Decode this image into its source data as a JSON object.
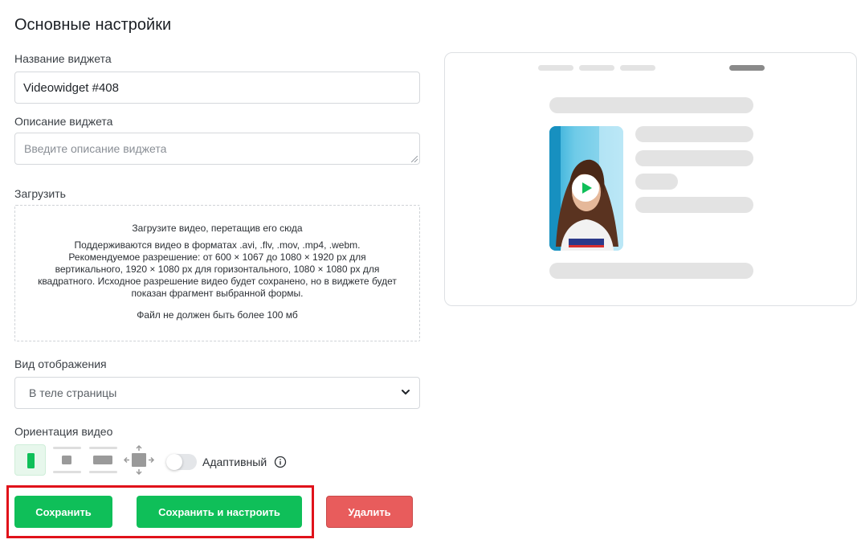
{
  "page": {
    "title": "Основные настройки"
  },
  "widget_name": {
    "label": "Название виджета",
    "value": "Videowidget #408"
  },
  "widget_description": {
    "label": "Описание виджета",
    "placeholder": "Введите описание виджета"
  },
  "upload": {
    "label": "Загрузить",
    "drop_title": "Загрузите видео, перетащив его сюда",
    "info": "Поддерживаются видео в форматах .avi, .flv, .mov, .mp4, .webm. Рекомендуемое разрешение: от 600 × 1067 до 1080 × 1920 px для вертикального, 1920 × 1080 px для горизонтального, 1080 × 1080 px для квадратного. Исходное разрешение видео будет сохранено, но в виджете будет показан фрагмент выбранной формы.",
    "limit": "Файл не должен быть более 100 мб"
  },
  "display_mode": {
    "label": "Вид отображения",
    "selected": "В теле страницы"
  },
  "orientation": {
    "label": "Ориентация видео",
    "options": [
      "vertical",
      "square",
      "horizontal",
      "free-resize"
    ],
    "selected": "vertical",
    "adaptive_label": "Адаптивный",
    "adaptive_on": false
  },
  "actions": {
    "save": "Сохранить",
    "save_and_configure": "Сохранить и настроить",
    "delete": "Удалить"
  },
  "colors": {
    "primary_green": "#0fbf59",
    "danger_red": "#e85c5c",
    "highlight_red": "#e0121a"
  }
}
